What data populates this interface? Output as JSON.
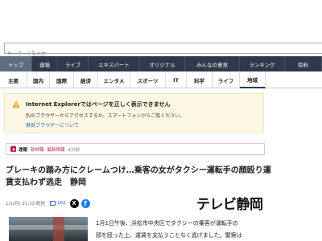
{
  "search": {
    "placeholder": "キーワードを入力"
  },
  "nav": [
    "トップ",
    "速報",
    "ライブ",
    "エキスパート",
    "オリジナル",
    "みんなの意見",
    "ランキング",
    "有料"
  ],
  "subnav": [
    "主要",
    "国内",
    "国際",
    "経済",
    "エンタメ",
    "スポーツ",
    "IT",
    "科学",
    "ライフ",
    "地域"
  ],
  "ie_warning": {
    "title": "Internet Explorerではページを正しく表示できません",
    "body": "別のブラウザーからアクセスするか、スマートフォンからご覧ください。",
    "link": "推奨ブラウザーについて"
  },
  "breaking": {
    "label": "速報",
    "new_label": "新詳報",
    "latest": "最新情報",
    "time": "1分前"
  },
  "headline": "ブレーキの踏み方にクレームつけ…乗客の女がタクシー運転手の顔殴り運賃支払わず逃走　静岡",
  "meta": {
    "date": "1/1(月) 21:13 配信",
    "comments": "162"
  },
  "source_logo": "テレビ静岡",
  "article_lines": [
    "1月1日午後、浜松市中央区でタクシーの乗客が運転手の",
    "顔を殴った上、運賃を支払うことなく逃げました。警察は"
  ]
}
